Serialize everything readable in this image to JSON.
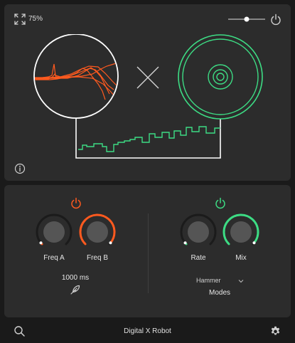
{
  "header": {
    "zoom_level": "75%"
  },
  "left_module": {
    "knobs": [
      {
        "label": "Freq A",
        "value": 0.02
      },
      {
        "label": "Freq B",
        "value": 0.98
      }
    ],
    "time_value": "1000 ms"
  },
  "right_module": {
    "knobs": [
      {
        "label": "Rate",
        "value": 0.02
      },
      {
        "label": "Mix",
        "value": 0.98
      }
    ],
    "mode_select": "Hammer",
    "modes_label": "Modes"
  },
  "footer": {
    "title": "Digital X Robot"
  },
  "colors": {
    "orange": "#ff5a1f",
    "green": "#3ddc84",
    "white": "#ffffff",
    "panel": "#2c2c2c",
    "background": "#1a1a1a"
  },
  "icons": [
    "fullscreen-icon",
    "power-icon",
    "info-icon",
    "feather-icon",
    "chevron-down-icon",
    "search-icon",
    "gear-icon"
  ]
}
